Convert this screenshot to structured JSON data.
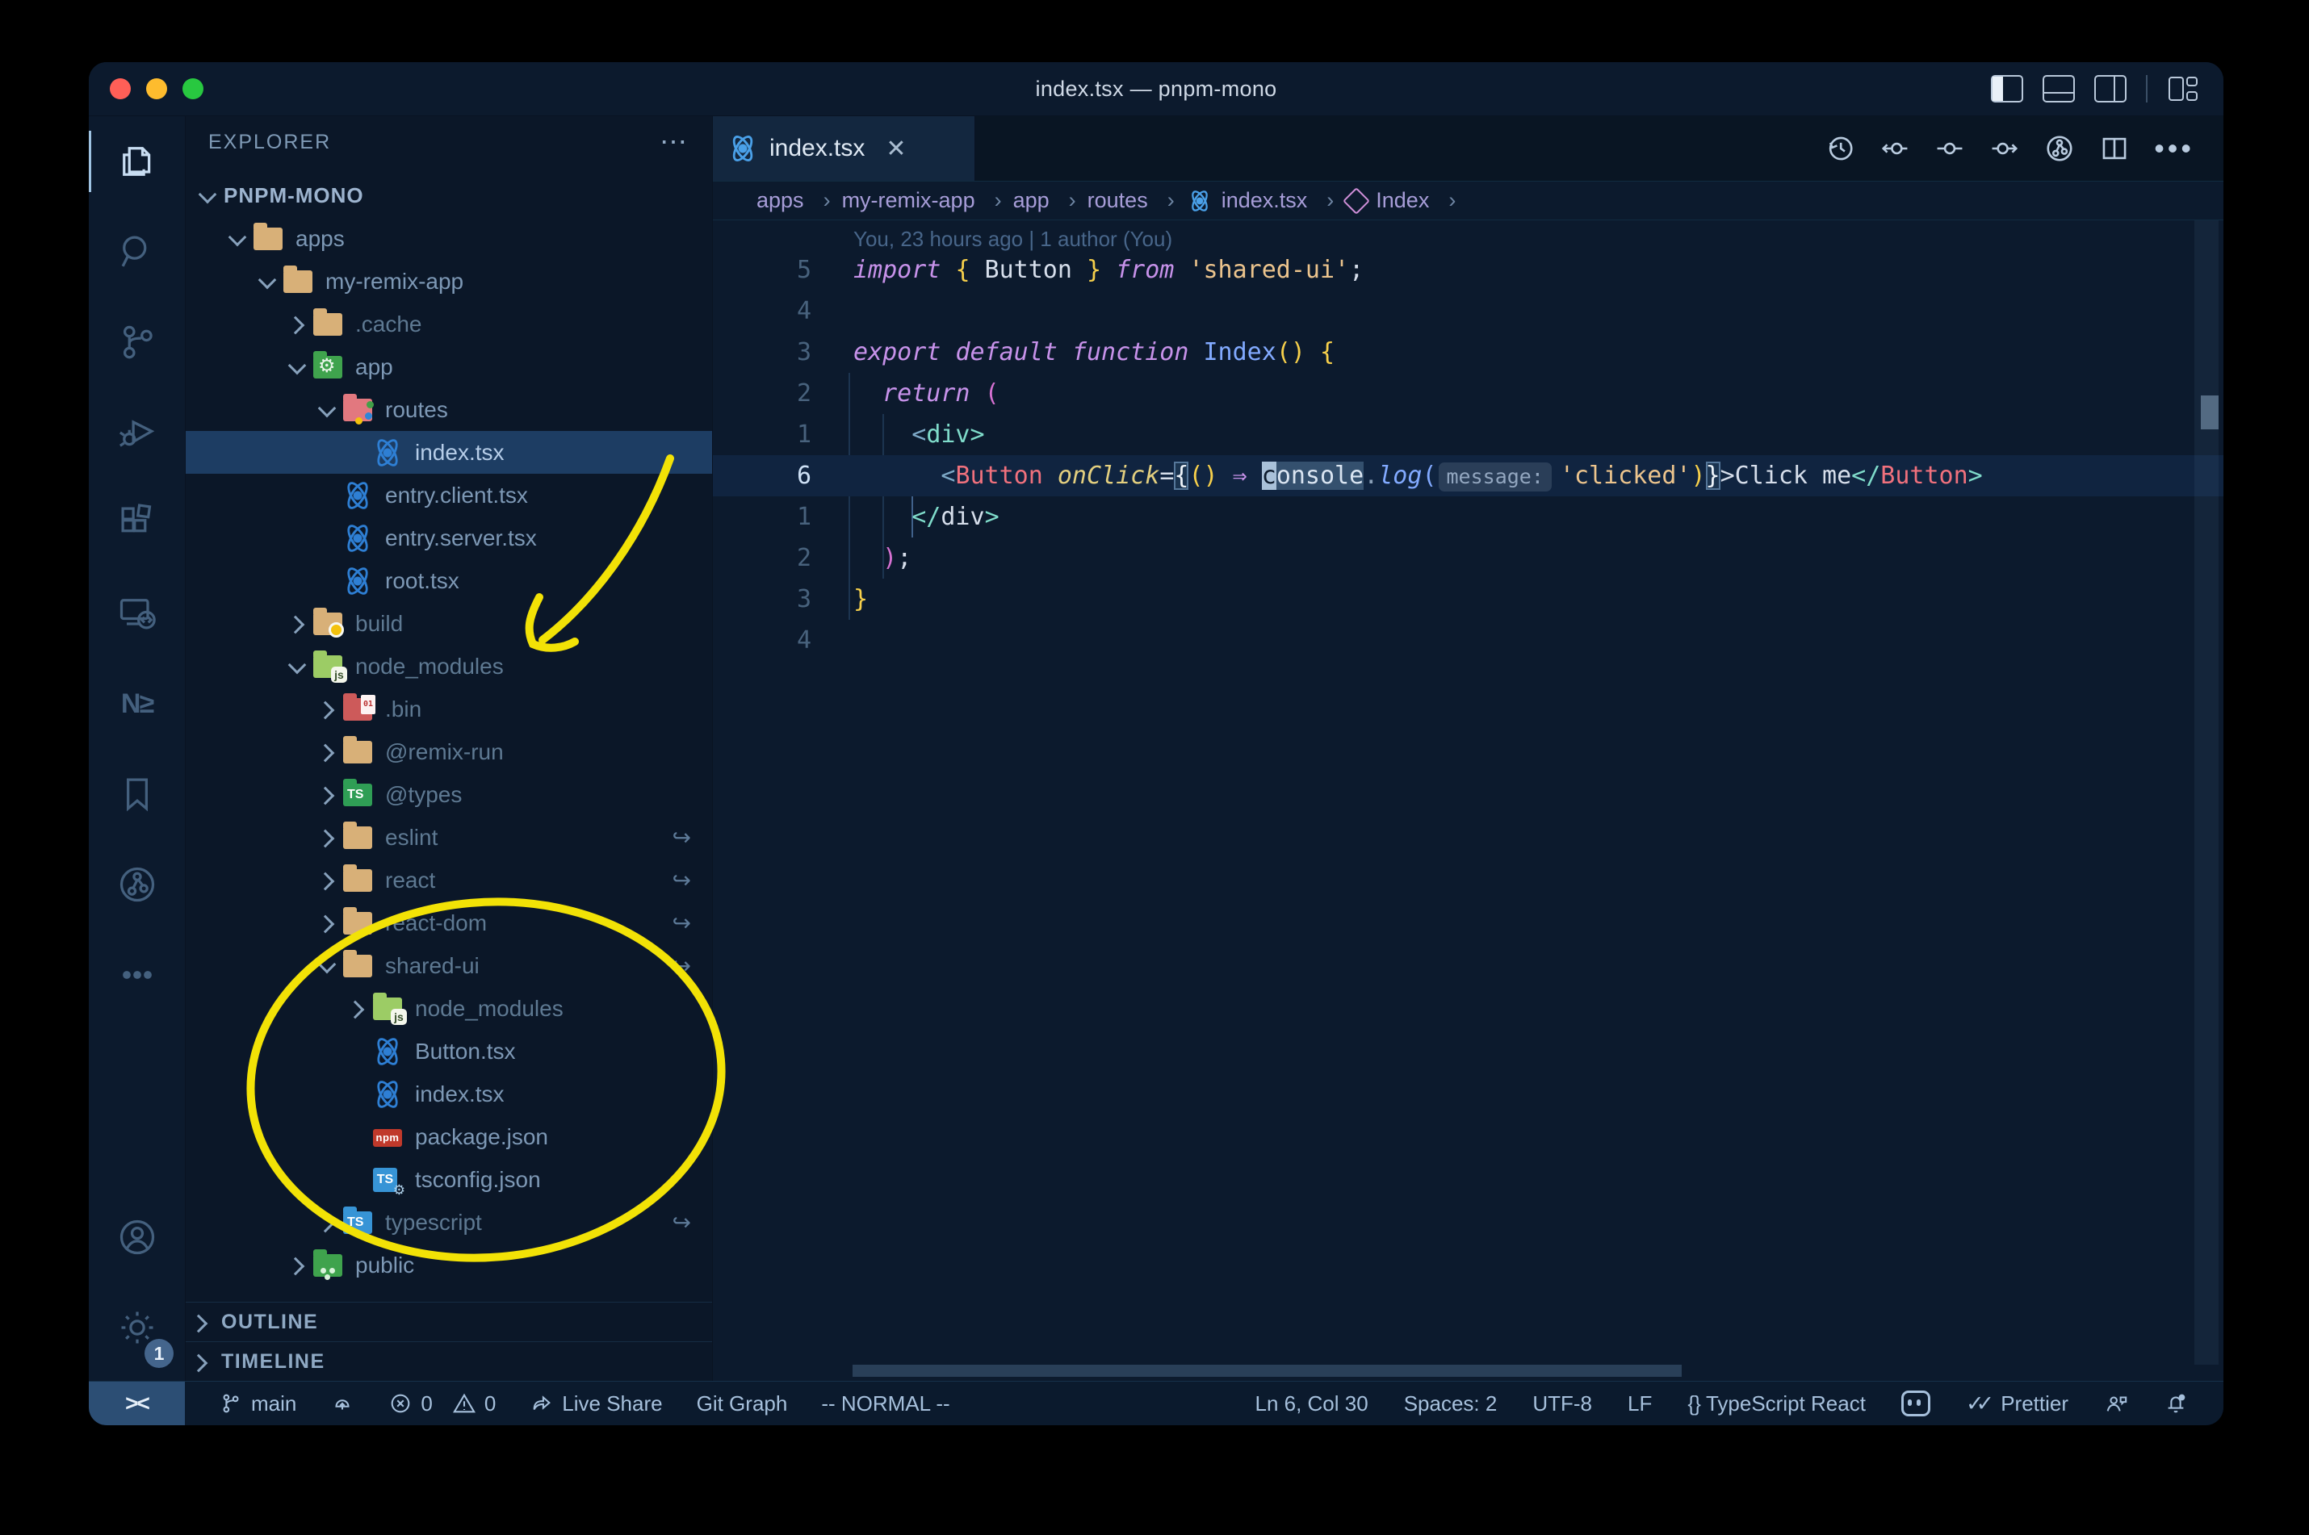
{
  "window": {
    "title": "index.tsx — pnpm-mono",
    "controls": [
      "close",
      "minimize",
      "zoom"
    ],
    "layout_icons": [
      "toggle-primary-sidebar",
      "toggle-panel",
      "toggle-secondary-sidebar",
      "customize-layout"
    ]
  },
  "colors": {
    "traffic_red": "#ff5f57",
    "traffic_yellow": "#febc2e",
    "traffic_green": "#28c840",
    "annotation_yellow": "#f2e206",
    "accent_selection": "#1d3d63"
  },
  "activity_bar": {
    "icons": [
      "explorer",
      "search",
      "source-control",
      "run-and-debug",
      "extensions",
      "remote-explorer",
      "nx-console",
      "bookmarks",
      "git-graph",
      "more",
      "account",
      "settings"
    ],
    "nx_glyph": "N≥",
    "settings_badge": "1"
  },
  "sidebar": {
    "header": "EXPLORER",
    "header_more": "⋯",
    "sections": {
      "outline": "OUTLINE",
      "timeline": "TIMELINE"
    },
    "tree": [
      {
        "label": "PNPM-MONO",
        "rowClass": "trow rootrow lv0",
        "chevClass": "chev down",
        "iconClass": "fi none",
        "lblClass": "lbl",
        "syml": ""
      },
      {
        "label": "apps",
        "rowClass": "trow lv1",
        "chevClass": "chev down",
        "iconClass": "fi fold c-tan",
        "lblClass": "lbl",
        "syml": ""
      },
      {
        "label": "my-remix-app",
        "rowClass": "trow lv2",
        "chevClass": "chev down",
        "iconClass": "fi fold c-tan",
        "lblClass": "lbl",
        "syml": ""
      },
      {
        "label": ".cache",
        "rowClass": "trow lv3",
        "chevClass": "chev right",
        "iconClass": "fi fold c-tan",
        "lblClass": "lbl dim",
        "syml": ""
      },
      {
        "label": "app",
        "rowClass": "trow lv3",
        "chevClass": "chev down",
        "iconClass": "fi fold c-green b-gear",
        "lblClass": "lbl",
        "syml": ""
      },
      {
        "label": "routes",
        "rowClass": "trow lv4",
        "chevClass": "chev down",
        "iconClass": "fi fold c-routes b-dots",
        "lblClass": "lbl",
        "syml": ""
      },
      {
        "label": "index.tsx",
        "rowClass": "trow sel lv5",
        "chevClass": "chev none",
        "iconClass": "fi react",
        "lblClass": "lbl",
        "syml": ""
      },
      {
        "label": "entry.client.tsx",
        "rowClass": "trow lv4",
        "chevClass": "chev none",
        "iconClass": "fi react",
        "lblClass": "lbl",
        "syml": ""
      },
      {
        "label": "entry.server.tsx",
        "rowClass": "trow lv4",
        "chevClass": "chev none",
        "iconClass": "fi react",
        "lblClass": "lbl",
        "syml": ""
      },
      {
        "label": "root.tsx",
        "rowClass": "trow lv4",
        "chevClass": "chev none",
        "iconClass": "fi react",
        "lblClass": "lbl",
        "syml": ""
      },
      {
        "label": "build",
        "rowClass": "trow lv3",
        "chevClass": "chev right",
        "iconClass": "fi fold c-tan b-dotY",
        "lblClass": "lbl dim",
        "syml": ""
      },
      {
        "label": "node_modules",
        "rowClass": "trow lv3",
        "chevClass": "chev down",
        "iconClass": "fi fold c-nm b-js",
        "lblClass": "lbl dim",
        "syml": ""
      },
      {
        "label": ".bin",
        "rowClass": "trow lv4",
        "chevClass": "chev right",
        "iconClass": "fi fold c-bin b-bin",
        "lblClass": "lbl dim",
        "syml": ""
      },
      {
        "label": "@remix-run",
        "rowClass": "trow lv4",
        "chevClass": "chev right",
        "iconClass": "fi fold c-tan",
        "lblClass": "lbl dim",
        "syml": ""
      },
      {
        "label": "@types",
        "rowClass": "trow lv4",
        "chevClass": "chev right",
        "iconClass": "fi fold c-types b-ts",
        "lblClass": "lbl dim",
        "syml": ""
      },
      {
        "label": "eslint",
        "rowClass": "trow lv4",
        "chevClass": "chev right",
        "iconClass": "fi fold c-tan",
        "lblClass": "lbl dim",
        "syml": "↪"
      },
      {
        "label": "react",
        "rowClass": "trow lv4",
        "chevClass": "chev right",
        "iconClass": "fi fold c-tan",
        "lblClass": "lbl dim",
        "syml": "↪"
      },
      {
        "label": "react-dom",
        "rowClass": "trow lv4",
        "chevClass": "chev right",
        "iconClass": "fi fold c-tan",
        "lblClass": "lbl dim",
        "syml": "↪"
      },
      {
        "label": "shared-ui",
        "rowClass": "trow lv4",
        "chevClass": "chev down",
        "iconClass": "fi fold c-tan",
        "lblClass": "lbl dim",
        "syml": "↪"
      },
      {
        "label": "node_modules",
        "rowClass": "trow lv5",
        "chevClass": "chev right",
        "iconClass": "fi fold c-nm b-js",
        "lblClass": "lbl dim",
        "syml": ""
      },
      {
        "label": "Button.tsx",
        "rowClass": "trow lv5",
        "chevClass": "chev none",
        "iconClass": "fi react",
        "lblClass": "lbl",
        "syml": ""
      },
      {
        "label": "index.tsx",
        "rowClass": "trow lv5",
        "chevClass": "chev none",
        "iconClass": "fi react",
        "lblClass": "lbl",
        "syml": ""
      },
      {
        "label": "package.json",
        "rowClass": "trow lv5",
        "chevClass": "chev none",
        "iconClass": "fi npm",
        "lblClass": "lbl",
        "syml": ""
      },
      {
        "label": "tsconfig.json",
        "rowClass": "trow lv5",
        "chevClass": "chev none",
        "iconClass": "fi tsj",
        "lblClass": "lbl",
        "syml": ""
      },
      {
        "label": "typescript",
        "rowClass": "trow lv4",
        "chevClass": "chev right",
        "iconClass": "fi fold c-tsblue b-ts",
        "lblClass": "lbl dim",
        "syml": "↪"
      },
      {
        "label": "public",
        "rowClass": "trow lv3",
        "chevClass": "chev right",
        "iconClass": "fi fold c-green b-ppl",
        "lblClass": "lbl",
        "syml": ""
      }
    ]
  },
  "tab": {
    "label": "index.tsx",
    "close": "✕"
  },
  "editor_actions": [
    "timeline-history",
    "previous-change",
    "open-change",
    "next-change",
    "git-graph",
    "split-editor",
    "more-actions"
  ],
  "breadcrumbs": [
    {
      "label": "apps",
      "iconClass": "bc-icon none"
    },
    {
      "label": "my-remix-app",
      "iconClass": "bc-icon none"
    },
    {
      "label": "app",
      "iconClass": "bc-icon none"
    },
    {
      "label": "routes",
      "iconClass": "bc-icon none"
    },
    {
      "label": "index.tsx",
      "iconClass": "bc-icon bc-react"
    },
    {
      "label": "Index",
      "iconClass": "bc-icon bc-cube"
    }
  ],
  "breadcrumb_sep": "›",
  "editor": {
    "blame": "You, 23 hours ago | 1 author (You)",
    "lines": [
      {
        "num": "5",
        "numClass": "ln",
        "rowClass": "cl",
        "tokens": [
          {
            "t": "import",
            "c": "tok kw"
          },
          {
            "t": " ",
            "c": "tok fg"
          },
          {
            "t": "{",
            "c": "tok gold"
          },
          {
            "t": " Button ",
            "c": "tok fg"
          },
          {
            "t": "}",
            "c": "tok gold"
          },
          {
            "t": " ",
            "c": "tok fg"
          },
          {
            "t": "from",
            "c": "tok kw"
          },
          {
            "t": " ",
            "c": "tok fg"
          },
          {
            "t": "'shared-ui'",
            "c": "tok str"
          },
          {
            "t": ";",
            "c": "tok fg"
          }
        ]
      },
      {
        "num": "4",
        "numClass": "ln",
        "rowClass": "cl",
        "tokens": []
      },
      {
        "num": "3",
        "numClass": "ln",
        "rowClass": "cl",
        "tokens": [
          {
            "t": "export",
            "c": "tok kw"
          },
          {
            "t": " ",
            "c": "tok fg"
          },
          {
            "t": "default",
            "c": "tok kw"
          },
          {
            "t": " ",
            "c": "tok fg"
          },
          {
            "t": "function",
            "c": "tok kw"
          },
          {
            "t": " ",
            "c": "tok fg"
          },
          {
            "t": "Index",
            "c": "tok blue"
          },
          {
            "t": "()",
            "c": "tok gold"
          },
          {
            "t": " ",
            "c": "tok fg"
          },
          {
            "t": "{",
            "c": "tok gold"
          }
        ]
      },
      {
        "num": "2",
        "numClass": "ln",
        "rowClass": "cl",
        "tokens": [
          {
            "t": "  ",
            "c": "tok fg"
          },
          {
            "t": "return",
            "c": "tok kw"
          },
          {
            "t": " ",
            "c": "tok fg"
          },
          {
            "t": "(",
            "c": "tok mag"
          }
        ]
      },
      {
        "num": "1",
        "numClass": "ln",
        "rowClass": "cl",
        "tokens": [
          {
            "t": "    ",
            "c": "tok fg"
          },
          {
            "t": "<",
            "c": "tok punct"
          },
          {
            "t": "div",
            "c": "tok teal"
          },
          {
            "t": ">",
            "c": "tok teal"
          }
        ]
      },
      {
        "num": "6",
        "numClass": "ln cur",
        "rowClass": "cl cur",
        "tokens": [
          {
            "t": "      ",
            "c": "tok fg"
          },
          {
            "t": "<",
            "c": "tok punct"
          },
          {
            "t": "Button",
            "c": "tok salmon"
          },
          {
            "t": " ",
            "c": "tok fg"
          },
          {
            "t": "onClick",
            "c": "tok attr"
          },
          {
            "t": "=",
            "c": "tok fg"
          },
          {
            "t": "{",
            "c": "tok brkt"
          },
          {
            "t": "()",
            "c": "tok gold"
          },
          {
            "t": " ",
            "c": "tok fg"
          },
          {
            "t": "⇒",
            "c": "tok arr"
          },
          {
            "t": " ",
            "c": "tok fg"
          },
          {
            "t": "c",
            "c": "tok cons cur"
          },
          {
            "t": "onsole",
            "c": "tok cons"
          },
          {
            "t": ".",
            "c": "tok dim2"
          },
          {
            "t": "log",
            "c": "tok blueit"
          },
          {
            "t": "(",
            "c": "tok blue"
          },
          {
            "t": "message:",
            "c": "tok inlay"
          },
          {
            "t": "'clicked'",
            "c": "tok str"
          },
          {
            "t": ")",
            "c": "tok gold"
          },
          {
            "t": "}",
            "c": "tok brkt"
          },
          {
            "t": ">",
            "c": "tok fg"
          },
          {
            "t": "Click me",
            "c": "tok fg"
          },
          {
            "t": "</",
            "c": "tok teal"
          },
          {
            "t": "Button",
            "c": "tok salmon"
          },
          {
            "t": ">",
            "c": "tok teal"
          }
        ]
      },
      {
        "num": "1",
        "numClass": "ln",
        "rowClass": "cl",
        "tokens": [
          {
            "t": "    ",
            "c": "tok fg"
          },
          {
            "t": "</",
            "c": "tok teal"
          },
          {
            "t": "div",
            "c": "tok fg"
          },
          {
            "t": ">",
            "c": "tok teal"
          }
        ]
      },
      {
        "num": "2",
        "numClass": "ln",
        "rowClass": "cl",
        "tokens": [
          {
            "t": "  ",
            "c": "tok fg"
          },
          {
            "t": ")",
            "c": "tok mag"
          },
          {
            "t": ";",
            "c": "tok fg"
          }
        ]
      },
      {
        "num": "3",
        "numClass": "ln",
        "rowClass": "cl",
        "tokens": [
          {
            "t": "}",
            "c": "tok gold"
          }
        ]
      },
      {
        "num": "4",
        "numClass": "ln",
        "rowClass": "cl",
        "tokens": []
      }
    ]
  },
  "status_bar": {
    "remote_glyph": "><",
    "branch": "main",
    "errors": "0",
    "warnings": "0",
    "live_share": "Live Share",
    "git_graph": "Git Graph",
    "vim_mode": "-- NORMAL --",
    "ln_col": "Ln 6, Col 30",
    "spaces": "Spaces: 2",
    "encoding": "UTF-8",
    "eol": "LF",
    "lang_icon": "{ }",
    "language": "TypeScript React",
    "prettier_checks": "✓✓",
    "prettier": "Prettier",
    "right_icons": [
      "copilot",
      "person-feedback",
      "bell-dot"
    ]
  }
}
